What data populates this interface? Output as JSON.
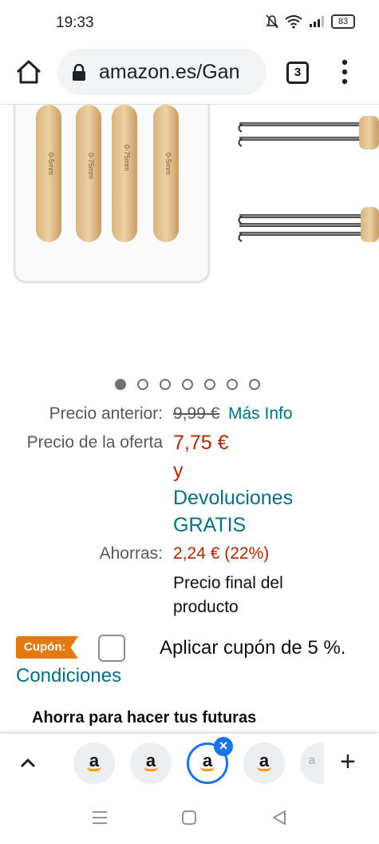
{
  "status_bar": {
    "time": "19:33",
    "battery": "83"
  },
  "browser": {
    "url": "amazon.es/Gan",
    "tab_count": "3",
    "home_icon": "home-icon",
    "lock_icon": "lock-icon",
    "menu_icon": "more-vert-icon"
  },
  "gallery": {
    "dot_count": 7,
    "active_index": 0
  },
  "product_image": {
    "hook_sizes": [
      "0-5mm",
      "0-75mm",
      "0-75mm",
      "0-5mm"
    ]
  },
  "price": {
    "previous_label": "Precio anterior:",
    "previous_value": "9,99 €",
    "more_info": "Más Info",
    "offer_label": "Precio de la oferta",
    "offer_value": "7,75 €",
    "and": "y",
    "returns_line1": "Devoluciones",
    "returns_line2": "GRATIS",
    "savings_label": "Ahorras:",
    "savings_value": "2,24 € (22%)",
    "final_line1": "Precio final del",
    "final_line2": "producto"
  },
  "coupon": {
    "badge": "Cupón:",
    "text": "Aplicar cupón de 5 %.",
    "conditions": "Condiciones"
  },
  "subheading": "Ahorra para hacer tus futuras",
  "tab_strip": {
    "tab_letter": "a",
    "add_label": "+"
  },
  "colors": {
    "accent_teal": "#007185",
    "price_red": "#b12704",
    "coupon_orange": "#e47911",
    "active_tab_blue": "#1a73e8"
  }
}
